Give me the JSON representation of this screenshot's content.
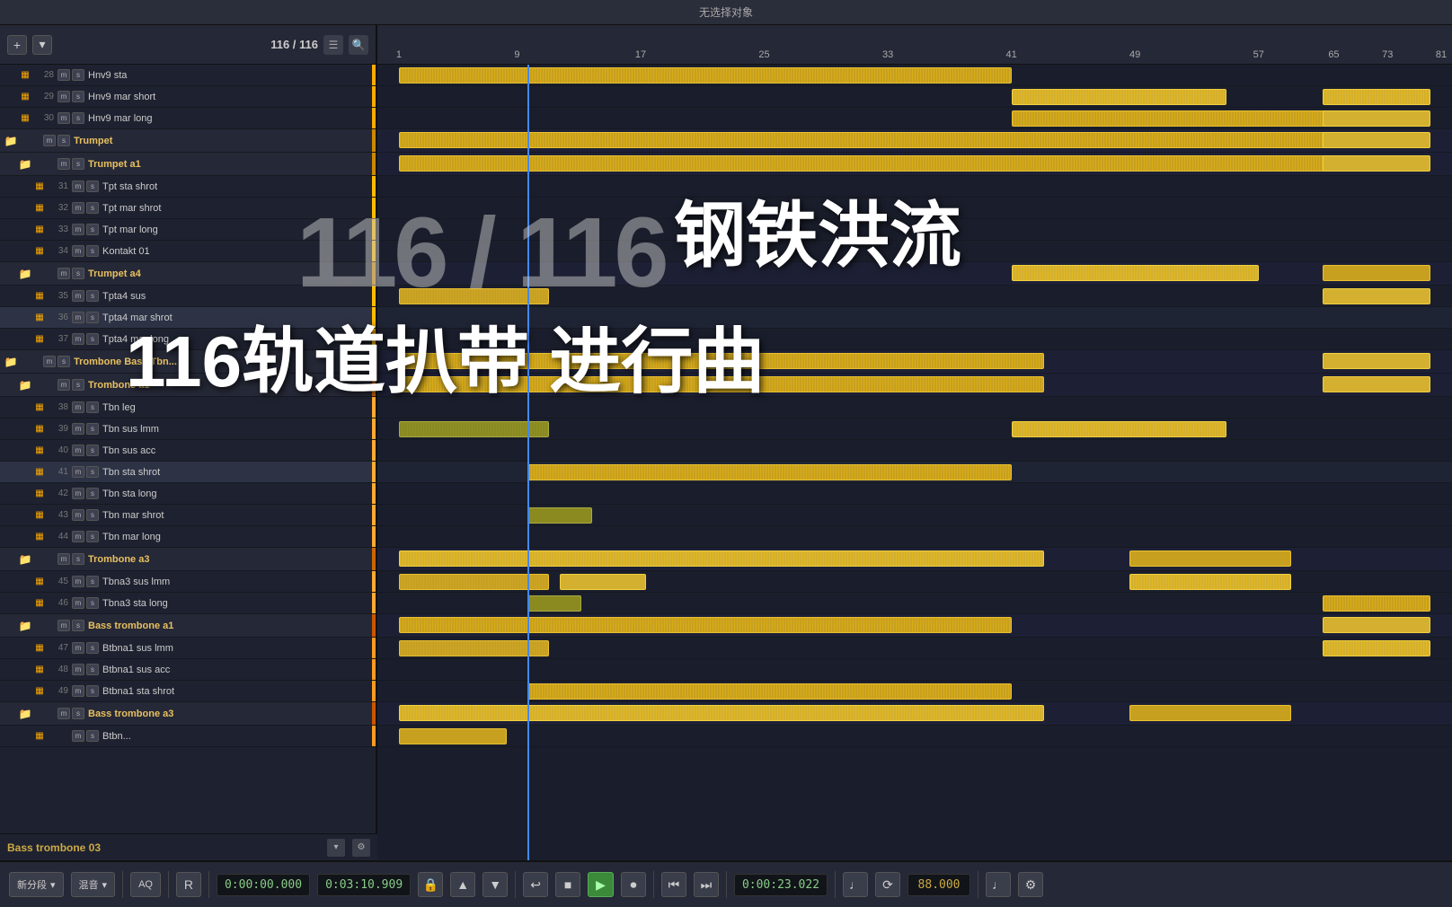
{
  "app": {
    "title": "无选择对象",
    "track_count": "116 / 116"
  },
  "overlay": {
    "counter": "116 / 116",
    "title_cn": "钢铁洪流",
    "subtitle_cn": "116轨道扒带   进行曲"
  },
  "transport": {
    "new_segment_label": "新分段",
    "mix_label": "混音",
    "aq_label": "AQ",
    "cursor_label": "R",
    "time_start": "0:00:00.000",
    "time_end": "0:03:10.909",
    "time_position": "0:00:23.022",
    "tempo": "88.000",
    "lock_icon": "🔒",
    "rewind_icon": "↩",
    "stop_icon": "■",
    "play_icon": "▶",
    "record_icon": "⏺",
    "prev_icon": "⏮",
    "next_icon": "⏭",
    "note_icon": "♩",
    "sync_icon": "⟳"
  },
  "ruler": {
    "marks": [
      {
        "label": "1",
        "pos": 0
      },
      {
        "label": "9",
        "pos": 12
      },
      {
        "label": "17",
        "pos": 24
      },
      {
        "label": "25",
        "pos": 36
      },
      {
        "label": "33",
        "pos": 48
      },
      {
        "label": "41",
        "pos": 60
      },
      {
        "label": "49",
        "pos": 72
      },
      {
        "label": "57",
        "pos": 84
      },
      {
        "label": "65",
        "pos": 96
      },
      {
        "label": "73",
        "pos": 108
      },
      {
        "label": "81",
        "pos": 120
      }
    ]
  },
  "tracks": [
    {
      "num": "28",
      "type": "audio",
      "name": "Hnv9 sta",
      "indent": 1,
      "color": "#ffaa00"
    },
    {
      "num": "29",
      "type": "audio",
      "name": "Hnv9 mar short",
      "indent": 1,
      "color": "#ffaa00"
    },
    {
      "num": "30",
      "type": "audio",
      "name": "Hnv9 mar long",
      "indent": 1,
      "color": "#ffaa00"
    },
    {
      "num": "",
      "type": "folder",
      "name": "Trumpet",
      "indent": 0,
      "color": "#cc8800"
    },
    {
      "num": "",
      "type": "folder",
      "name": "Trumpet a1",
      "indent": 1,
      "color": "#cc8800"
    },
    {
      "num": "31",
      "type": "audio",
      "name": "Tpt sta shrot",
      "indent": 2,
      "color": "#ffbb00"
    },
    {
      "num": "32",
      "type": "audio",
      "name": "Tpt mar shrot",
      "indent": 2,
      "color": "#ffbb00"
    },
    {
      "num": "33",
      "type": "audio",
      "name": "Tpt mar long",
      "indent": 2,
      "color": "#ffbb00"
    },
    {
      "num": "34",
      "type": "audio",
      "name": "Kontakt 01",
      "indent": 2,
      "color": "#ffbb00"
    },
    {
      "num": "",
      "type": "folder",
      "name": "Trumpet a4",
      "indent": 1,
      "color": "#cc8800"
    },
    {
      "num": "35",
      "type": "audio",
      "name": "Tpta4 sus",
      "indent": 2,
      "color": "#ffbb00"
    },
    {
      "num": "36",
      "type": "audio",
      "name": "Tpta4 mar shrot",
      "indent": 2,
      "color": "#ffbb00"
    },
    {
      "num": "37",
      "type": "audio",
      "name": "Tpta4 mar long",
      "indent": 2,
      "color": "#ffbb00"
    },
    {
      "num": "",
      "type": "folder",
      "name": "Trombone Bass Tbn...",
      "indent": 0,
      "color": "#cc6600"
    },
    {
      "num": "",
      "type": "folder",
      "name": "Trombone a1",
      "indent": 1,
      "color": "#cc6600"
    },
    {
      "num": "38",
      "type": "audio",
      "name": "Tbn leg",
      "indent": 2,
      "color": "#ffaa33"
    },
    {
      "num": "39",
      "type": "audio",
      "name": "Tbn sus lmm",
      "indent": 2,
      "color": "#ffaa33"
    },
    {
      "num": "40",
      "type": "audio",
      "name": "Tbn sus acc",
      "indent": 2,
      "color": "#ffaa33"
    },
    {
      "num": "41",
      "type": "audio",
      "name": "Tbn sta shrot",
      "indent": 2,
      "color": "#ffaa33"
    },
    {
      "num": "42",
      "type": "audio",
      "name": "Tbn sta long",
      "indent": 2,
      "color": "#ffaa33"
    },
    {
      "num": "43",
      "type": "audio",
      "name": "Tbn mar shrot",
      "indent": 2,
      "color": "#ffaa33"
    },
    {
      "num": "44",
      "type": "audio",
      "name": "Tbn mar long",
      "indent": 2,
      "color": "#ffaa33"
    },
    {
      "num": "",
      "type": "folder",
      "name": "Trombone a3",
      "indent": 1,
      "color": "#cc6600"
    },
    {
      "num": "45",
      "type": "audio",
      "name": "Tbna3 sus lmm",
      "indent": 2,
      "color": "#ffaa33"
    },
    {
      "num": "46",
      "type": "audio",
      "name": "Tbna3 sta long",
      "indent": 2,
      "color": "#ffaa33"
    },
    {
      "num": "",
      "type": "folder",
      "name": "Bass trombone a1",
      "indent": 1,
      "color": "#cc5500"
    },
    {
      "num": "47",
      "type": "audio",
      "name": "Btbna1 sus lmm",
      "indent": 2,
      "color": "#ff9922"
    },
    {
      "num": "48",
      "type": "audio",
      "name": "Btbna1 sus acc",
      "indent": 2,
      "color": "#ff9922"
    },
    {
      "num": "49",
      "type": "audio",
      "name": "Btbna1 sta shrot",
      "indent": 2,
      "color": "#ff9922"
    },
    {
      "num": "",
      "type": "folder",
      "name": "Bass trombone a3",
      "indent": 1,
      "color": "#cc5500"
    },
    {
      "num": "",
      "type": "audio",
      "name": "Btbn...",
      "indent": 2,
      "color": "#ff9922"
    }
  ],
  "bottom_track": {
    "name": "Bass trombone 03"
  }
}
